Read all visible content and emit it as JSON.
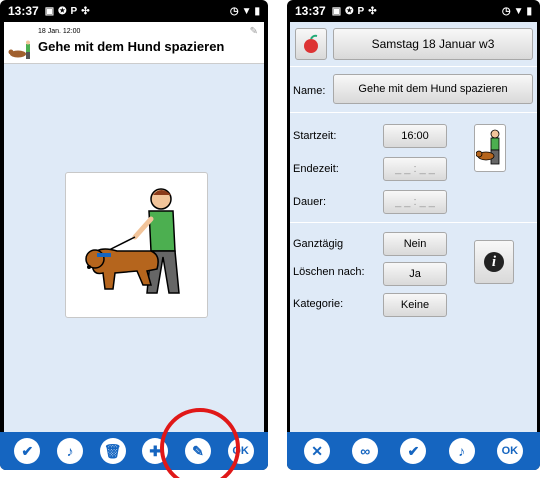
{
  "left": {
    "status": {
      "time": "13:37"
    },
    "event": {
      "date": "18 Jan. 12:00",
      "title": "Gehe mit dem Hund spazieren"
    }
  },
  "right": {
    "status": {
      "time": "13:37"
    },
    "date_button": "Samstag 18 Januar w3",
    "name_label": "Name:",
    "name_value": "Gehe mit dem Hund spazieren",
    "start_label": "Startzeit:",
    "start_value": "16:00",
    "end_label": "Endezeit:",
    "end_value": "_ _ : _ _",
    "duration_label": "Dauer:",
    "duration_value": "_ _ : _ _",
    "allday_label": "Ganztägig",
    "allday_value": "Nein",
    "delete_label": "Löschen nach:",
    "delete_value": "Ja",
    "category_label": "Kategorie:",
    "category_value": "Keine"
  },
  "nav": {
    "ok": "OK"
  },
  "colors": {
    "navbar": "#1565c0",
    "screen": "#dfeaf7",
    "highlight": "#e01818"
  }
}
